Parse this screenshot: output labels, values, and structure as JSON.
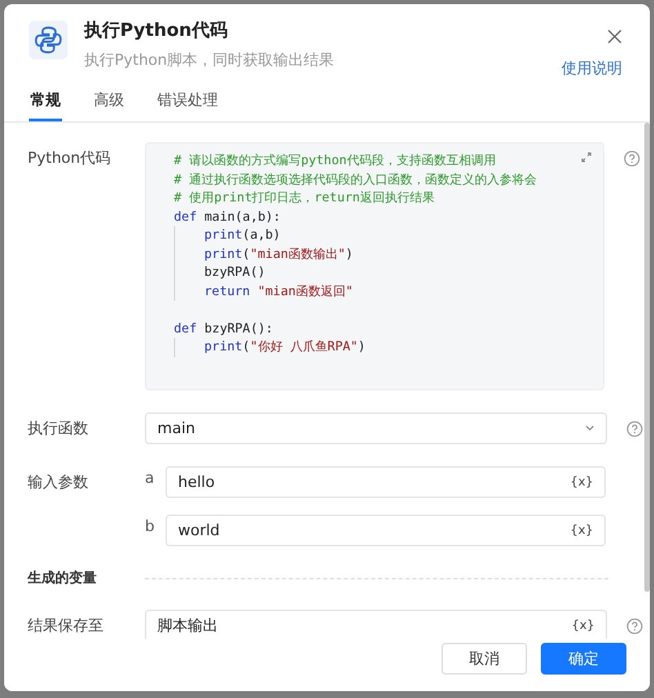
{
  "dialog": {
    "title": "执行Python代码",
    "subtitle": "执行Python脚本，同时获取输出结果",
    "help_link": "使用说明"
  },
  "tabs": [
    {
      "label": "常规",
      "selected": true
    },
    {
      "label": "高级",
      "selected": false
    },
    {
      "label": "错误处理",
      "selected": false
    }
  ],
  "code": {
    "label": "Python代码",
    "lines": [
      {
        "indented": false,
        "tokens": [
          {
            "kind": "comment",
            "text": "# 请以函数的方式编写python代码段，支持函数互相调用"
          }
        ]
      },
      {
        "indented": false,
        "tokens": [
          {
            "kind": "comment",
            "text": "# 通过执行函数选项选择代码段的入口函数，函数定义的入参将会"
          }
        ]
      },
      {
        "indented": false,
        "tokens": [
          {
            "kind": "comment",
            "text": "# 使用print打印日志，return返回执行结果"
          }
        ]
      },
      {
        "indented": false,
        "tokens": [
          {
            "kind": "keyword",
            "text": "def"
          },
          {
            "kind": "plain",
            "text": " main(a,b):"
          }
        ]
      },
      {
        "indented": true,
        "tokens": [
          {
            "kind": "keyword",
            "text": "print"
          },
          {
            "kind": "plain",
            "text": "(a,b)"
          }
        ]
      },
      {
        "indented": true,
        "tokens": [
          {
            "kind": "keyword",
            "text": "print"
          },
          {
            "kind": "plain",
            "text": "("
          },
          {
            "kind": "string",
            "text": "\"mian函数输出\""
          },
          {
            "kind": "plain",
            "text": ")"
          }
        ]
      },
      {
        "indented": true,
        "tokens": [
          {
            "kind": "plain",
            "text": "bzyRPA()"
          }
        ]
      },
      {
        "indented": true,
        "tokens": [
          {
            "kind": "keyword",
            "text": "return"
          },
          {
            "kind": "string",
            "text": " \"mian函数返回\""
          }
        ]
      },
      {
        "indented": false,
        "gap_before": true,
        "tokens": [
          {
            "kind": "keyword",
            "text": "def"
          },
          {
            "kind": "plain",
            "text": " bzyRPA():"
          }
        ]
      },
      {
        "indented": true,
        "tokens": [
          {
            "kind": "keyword",
            "text": "print"
          },
          {
            "kind": "plain",
            "text": "("
          },
          {
            "kind": "string",
            "text": "\"你好 八爪鱼RPA\""
          },
          {
            "kind": "plain",
            "text": ")"
          }
        ]
      }
    ]
  },
  "function_select": {
    "label": "执行函数",
    "value": "main"
  },
  "input_params": {
    "label": "输入参数",
    "params": [
      {
        "name": "a",
        "value": "hello",
        "var_tag": "{x}"
      },
      {
        "name": "b",
        "value": "world",
        "var_tag": "{x}"
      }
    ]
  },
  "section": "生成的变量",
  "result_field": {
    "label": "结果保存至",
    "value": "脚本输出",
    "var_tag": "{x}"
  },
  "buttons": [
    {
      "label": "取消",
      "kind": "secondary"
    },
    {
      "label": "确定",
      "kind": "primary"
    }
  ]
}
